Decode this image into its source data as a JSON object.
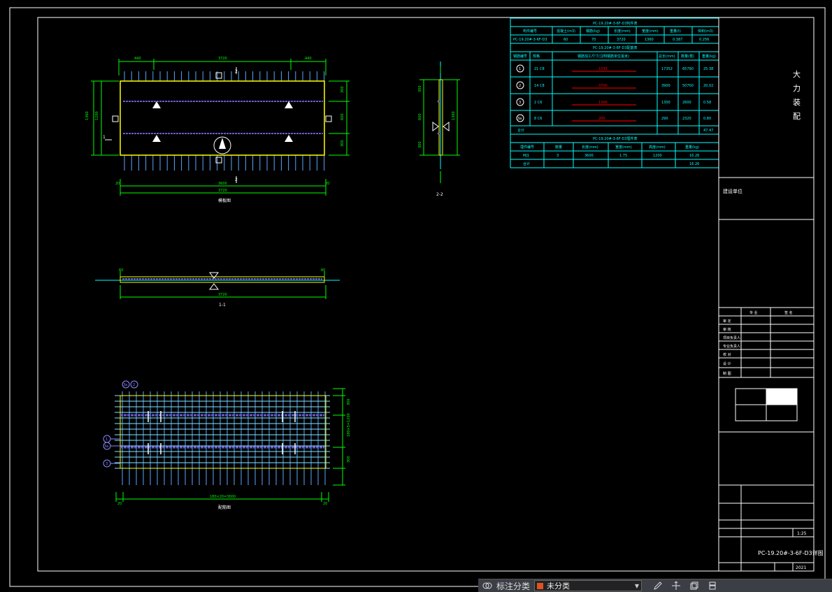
{
  "title_block": {
    "company": [
      "大",
      "力",
      "装",
      "配"
    ],
    "drawing_name": "PC-19.20#-3-6F-D3详图",
    "ratio_value": "1:25",
    "date_value": "2021",
    "construction_unit": "建设单位",
    "sign_header": [
      "专 业",
      "签 名"
    ],
    "rows": [
      "审 定",
      "审 核",
      "项目负责人",
      "专业负责人",
      "校 对",
      "设 计",
      "制 图"
    ]
  },
  "tables": {
    "component": {
      "title": "PC-19.20#-3-6F-D3构件表",
      "headers": [
        "构件编号",
        "混凝土(m3)",
        "钢筋(kg)",
        "长度(mm)",
        "宽度(mm)",
        "重量(t)",
        "体积(m3)"
      ],
      "row": [
        "PC-19.20#-3-6F-D3",
        "60",
        "70",
        "3720",
        "1360",
        "0.387",
        "0.256"
      ]
    },
    "rebar": {
      "title": "PC-19.20#-3-6F-D3配筋表",
      "headers": [
        "钢筋编号",
        "规格",
        "钢筋加工尺寸(注明钢筋单位毫米)",
        "总长(mm)",
        "数量(根)",
        "重量(kg)"
      ],
      "rows": [
        {
          "id": "1",
          "spec": "21 C8",
          "dim": "1035",
          "len": "17352",
          "count": "65790",
          "weight": "25.38"
        },
        {
          "id": "2",
          "spec": "14 C8",
          "dim": "3700",
          "len": "3900",
          "count": "50700",
          "weight": "20.02"
        },
        {
          "id": "3",
          "spec": "2 C6",
          "dim": "1300",
          "len": "1300",
          "count": "2600",
          "weight": "0.58"
        },
        {
          "id": "3a",
          "spec": "8 C6",
          "dim": "200",
          "len": "290",
          "count": "2320",
          "weight": "0.80"
        }
      ],
      "total_label": "合计",
      "total": "47.47"
    },
    "embed": {
      "title": "PC-19.20#-3-6F-D3埋件表",
      "headers": [
        "埋件编号",
        "数量",
        "长度(mm)",
        "宽度(mm)",
        "高度(mm)",
        "重量(kg)"
      ],
      "rows": [
        [
          "MJ1",
          "3",
          "3600",
          "1.75",
          "1200",
          "16.26"
        ],
        [
          "合计",
          "",
          "",
          "",
          "",
          "16.26"
        ]
      ]
    }
  },
  "views": {
    "plan_label": "模板图",
    "section11_label": "1-1",
    "section22_label": "2-2",
    "rebar_label": "配筋图",
    "dims_top": [
      "440",
      "3720",
      "440"
    ],
    "dim_bottom": "3720",
    "dim_bottom_inner": "3600",
    "dim_rebar": "180×20=3600"
  },
  "toolbar": {
    "label": "标注分类",
    "layer": "未分类"
  },
  "colors": {
    "cyan": "#00ffff",
    "green": "#00ff00",
    "yellow": "#ffff00",
    "purple": "#6a5acd",
    "red": "#ff0000",
    "frame": "#ffffff"
  }
}
